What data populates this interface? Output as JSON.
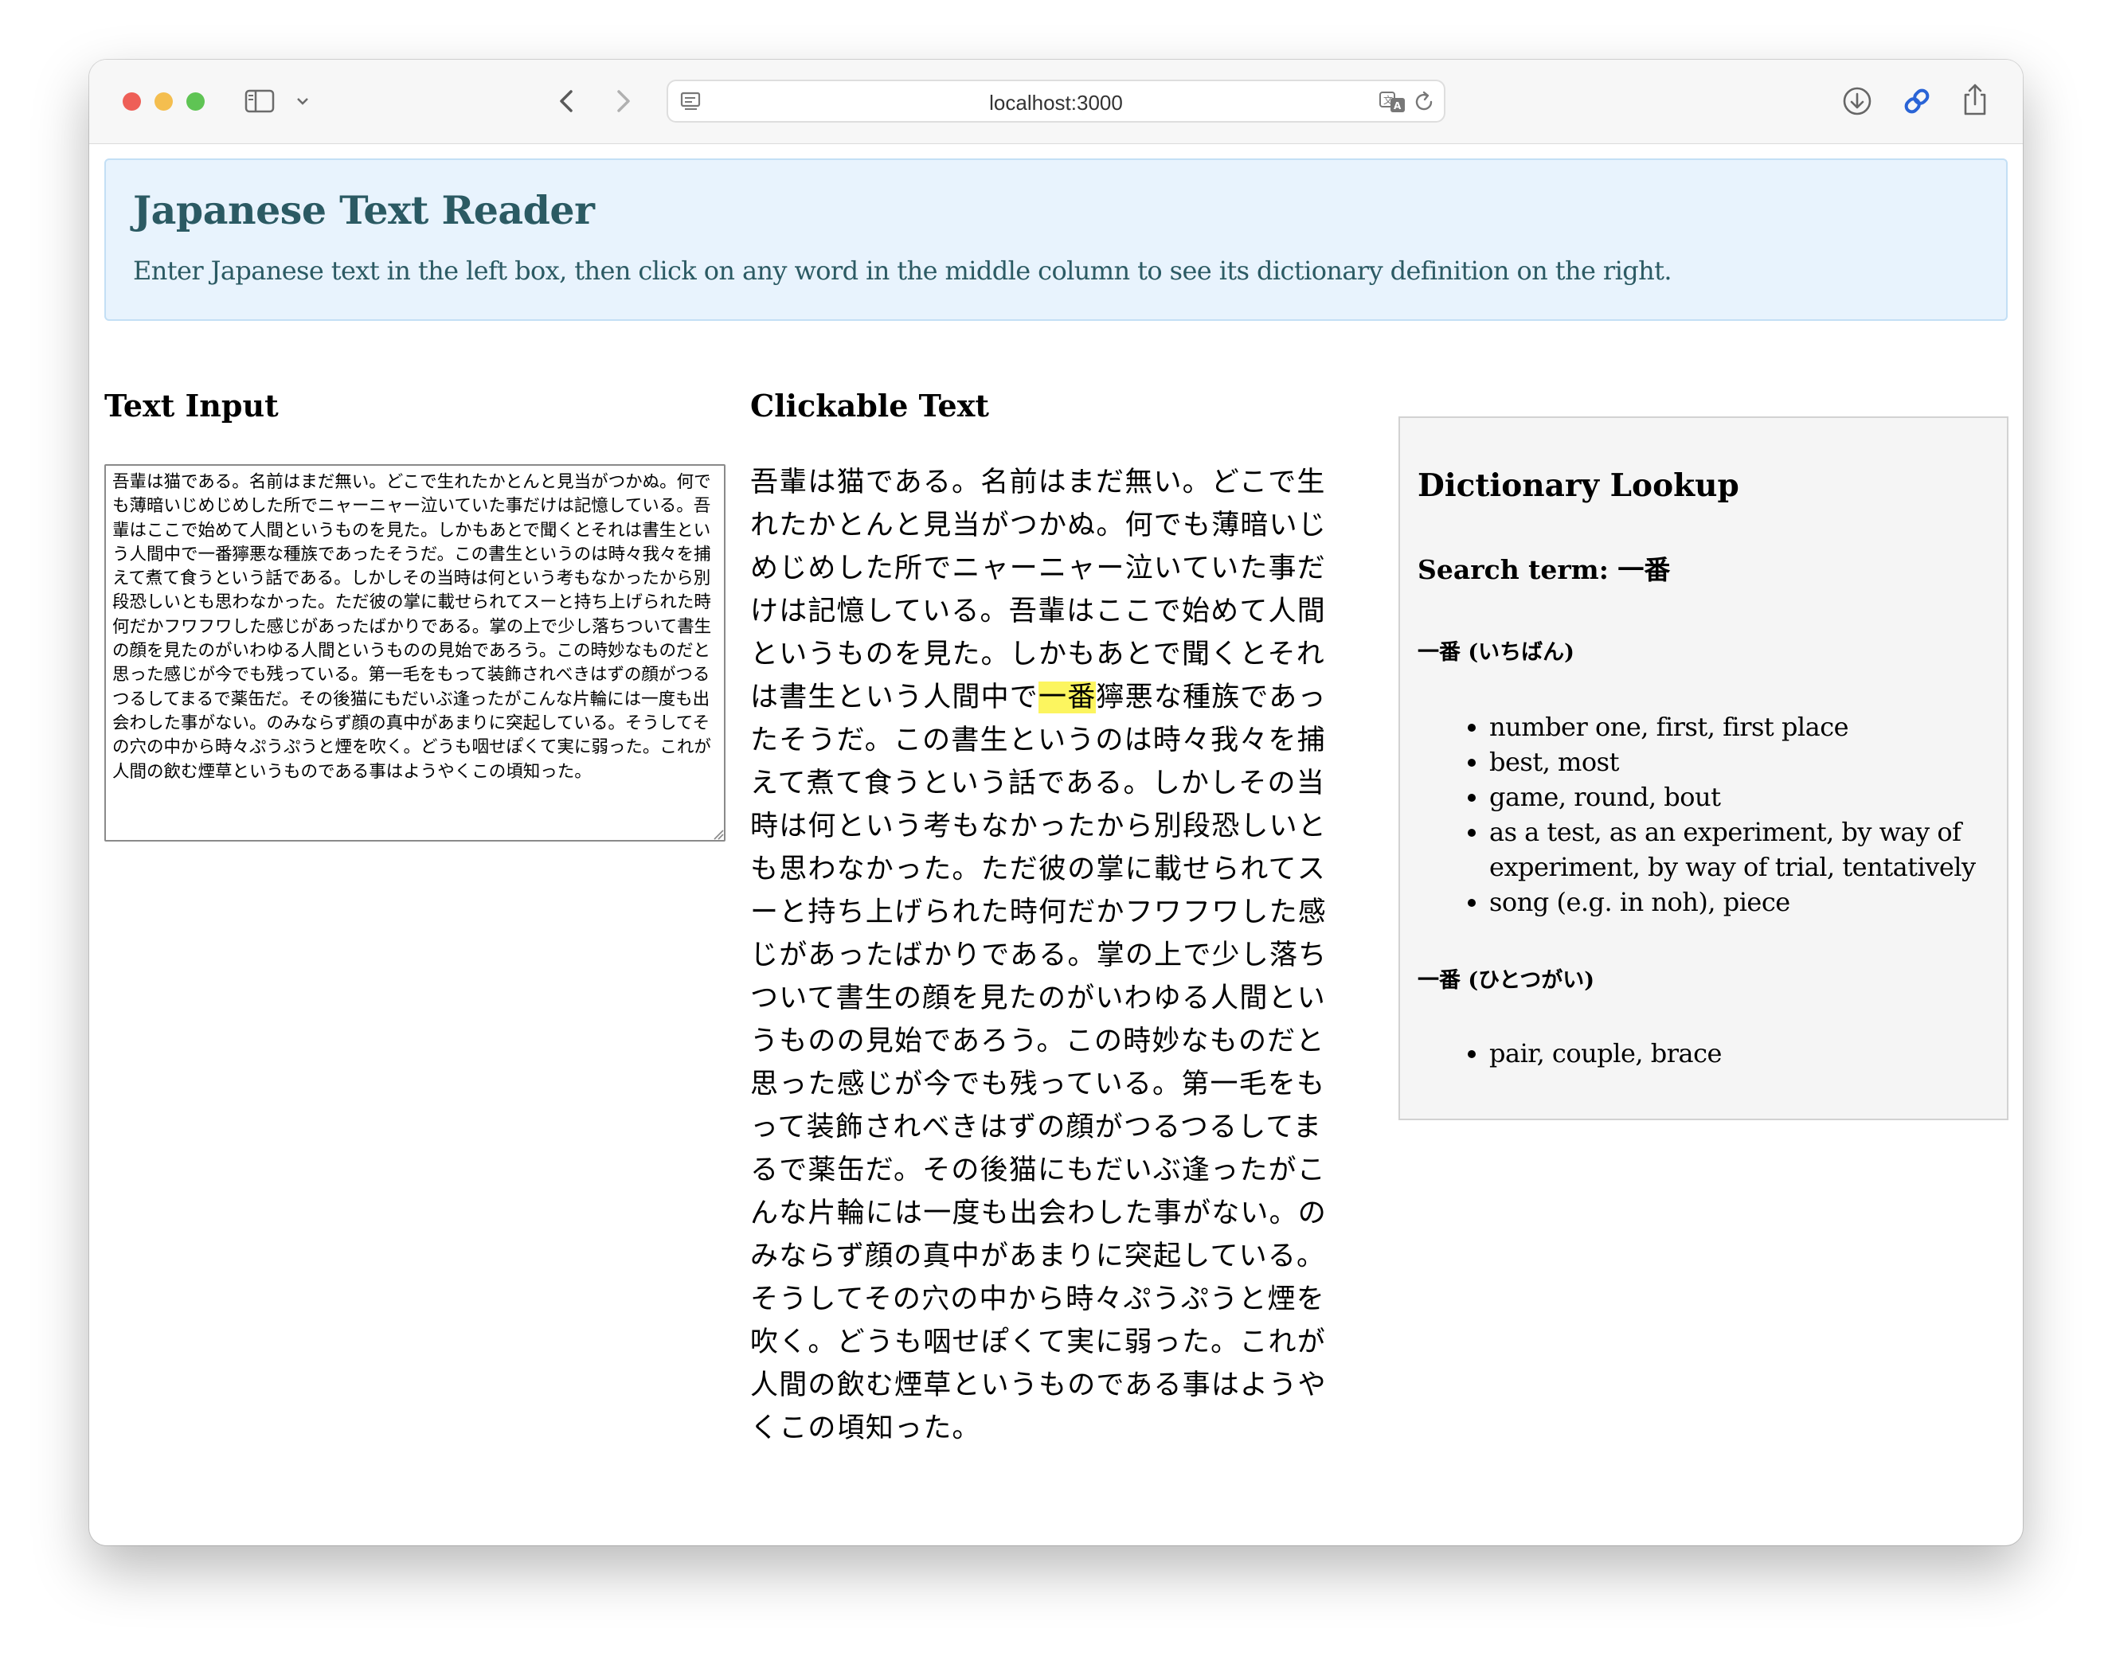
{
  "browser": {
    "url": "localhost:3000"
  },
  "banner": {
    "title": "Japanese Text Reader",
    "description": "Enter Japanese text in the left box, then click on any word in the middle column to see its dictionary definition on the right."
  },
  "input_panel": {
    "title": "Text Input",
    "value": "吾輩は猫である。名前はまだ無い。どこで生れたかとんと見当がつかぬ。何でも薄暗いじめじめした所でニャーニャー泣いていた事だけは記憶している。吾輩はここで始めて人間というものを見た。しかもあとで聞くとそれは書生という人間中で一番獰悪な種族であったそうだ。この書生というのは時々我々を捕えて煮て食うという話である。しかしその当時は何という考もなかったから別段恐しいとも思わなかった。ただ彼の掌に載せられてスーと持ち上げられた時何だかフワフワした感じがあったばかりである。掌の上で少し落ちついて書生の顔を見たのがいわゆる人間というものの見始であろう。この時妙なものだと思った感じが今でも残っている。第一毛をもって装飾されべきはずの顔がつるつるしてまるで薬缶だ。その後猫にもだいぶ逢ったがこんな片輪には一度も出会わした事がない。のみならず顔の真中があまりに突起している。そうしてその穴の中から時々ぷうぷうと煙を吹く。どうも咽せぽくて実に弱った。これが人間の飲む煙草というものである事はようやくこの頃知った。"
  },
  "clickable_panel": {
    "title": "Clickable Text",
    "before": "吾輩は猫である。名前はまだ無い。どこで生れたかとんと見当がつかぬ。何でも薄暗いじめじめした所でニャーニャー泣いていた事だけは記憶している。吾輩はここで始めて人間というものを見た。しかもあとで聞くとそれは書生という人間中で",
    "highlighted": "一番",
    "after": "獰悪な種族であったそうだ。この書生というのは時々我々を捕えて煮て食うという話である。しかしその当時は何という考もなかったから別段恐しいとも思わなかった。ただ彼の掌に載せられてスーと持ち上げられた時何だかフワフワした感じがあったばかりである。掌の上で少し落ちついて書生の顔を見たのがいわゆる人間というものの見始であろう。この時妙なものだと思った感じが今でも残っている。第一毛をもって装飾されべきはずの顔がつるつるしてまるで薬缶だ。その後猫にもだいぶ逢ったがこんな片輪には一度も出会わした事がない。のみならず顔の真中があまりに突起している。そうしてその穴の中から時々ぷうぷうと煙を吹く。どうも咽せぽくて実に弱った。これが人間の飲む煙草というものである事はようやくこの頃知った。",
    "highlight_color": "#fcf55f"
  },
  "dictionary": {
    "title": "Dictionary Lookup",
    "search_term": "Search term: 一番",
    "entries": [
      {
        "heading": "一番 (いちばん)",
        "senses": [
          "number one, first, first place",
          "best, most",
          "game, round, bout",
          "as a test, as an experiment, by way of experiment, by way of trial, tentatively",
          "song (e.g. in noh), piece"
        ]
      },
      {
        "heading": "一番 (ひとつがい)",
        "senses": [
          "pair, couple, brace"
        ]
      }
    ]
  },
  "colors": {
    "banner_bg": "#e8f3fd",
    "banner_text": "#2b5a63",
    "dict_bg": "#f5f5f5"
  }
}
